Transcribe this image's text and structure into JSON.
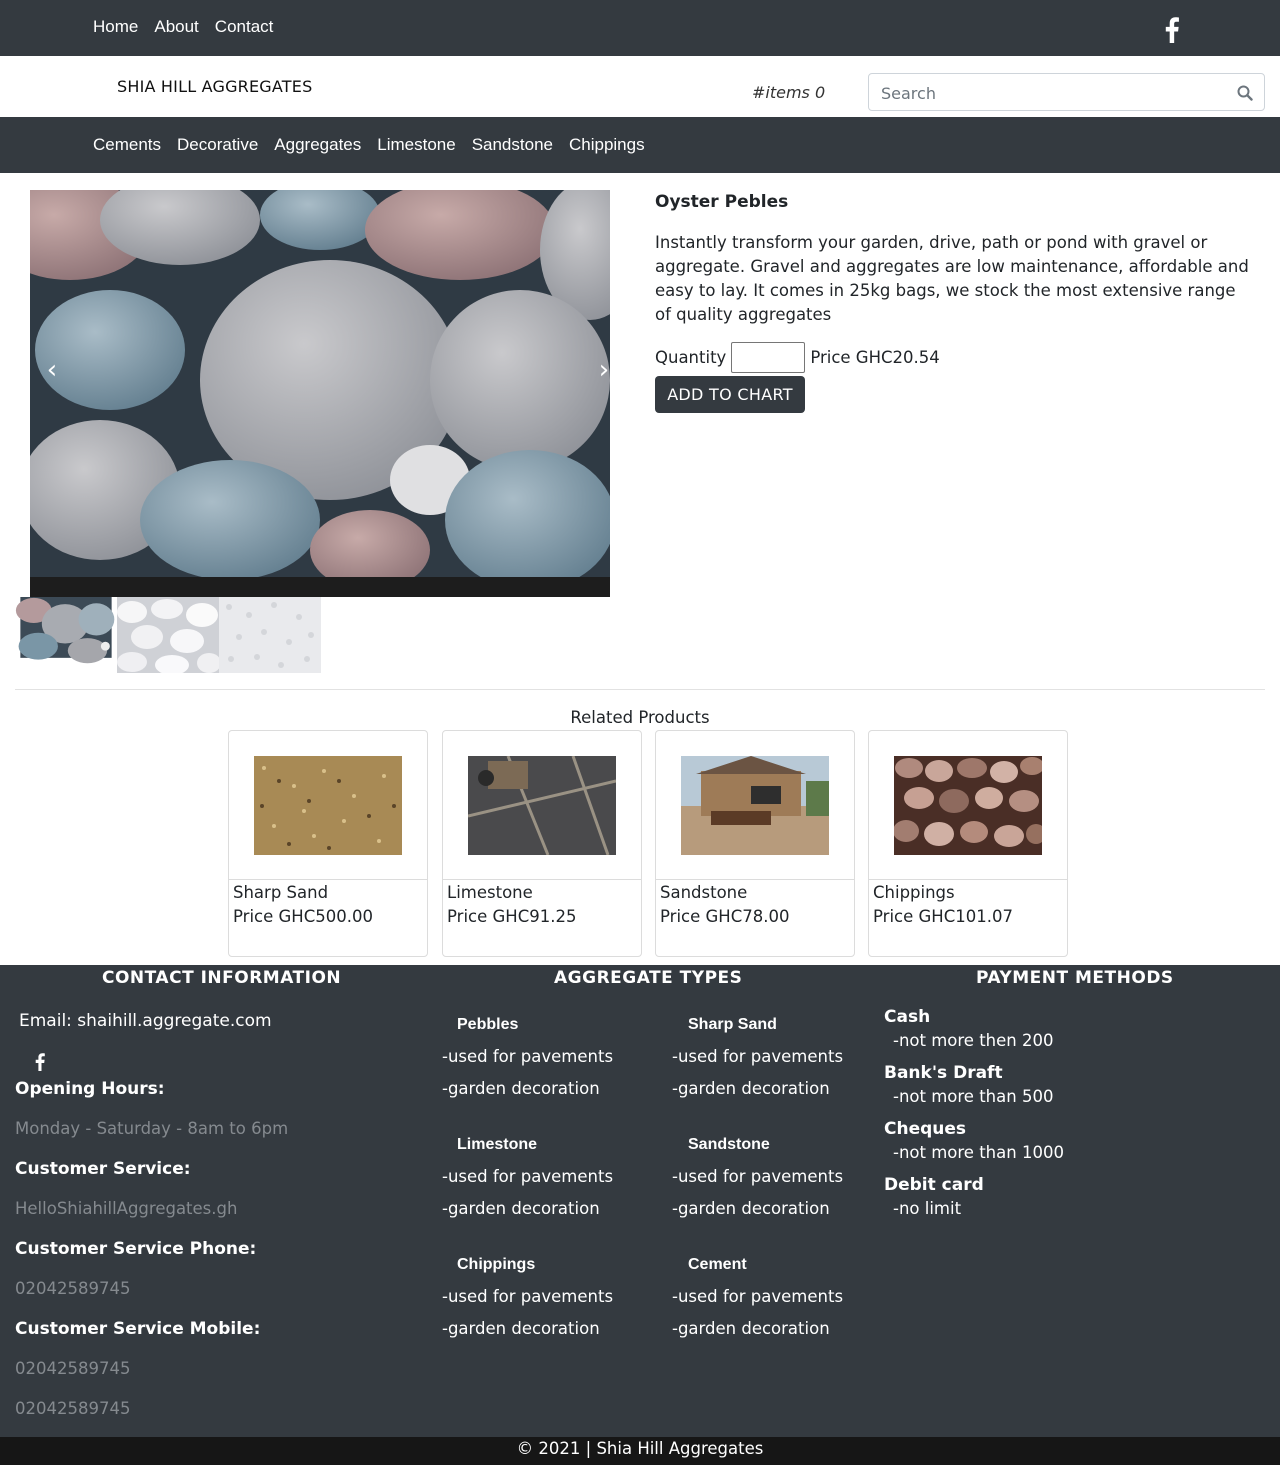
{
  "top_nav": {
    "links": [
      "Home",
      "About",
      "Contact"
    ],
    "social_icon": "facebook-icon"
  },
  "header": {
    "brand": "SHIA HILL AGGREGATES",
    "cart_count": "#items 0",
    "search_placeholder": "Search",
    "search_icon": "search-icon"
  },
  "categories": [
    "Cements",
    "Decorative",
    "Aggregates",
    "Limestone",
    "Sandstone",
    "Chippings"
  ],
  "product": {
    "title": "Oyster Pebles",
    "description": "Instantly transform your garden, drive, path or pond with gravel or aggregate. Gravel and aggregates are low maintenance, affordable and easy to lay. It comes in 25kg bags, we stock the most extensive range of quality aggregates",
    "quantity_label": "Quantity",
    "quantity_value": "",
    "price": "Price GHC20.54",
    "add_button": "ADD TO CHART",
    "carousel_prev": "‹",
    "carousel_next": "›"
  },
  "related": {
    "title": "Related Products",
    "items": [
      {
        "name": "Sharp Sand",
        "price": "Price GHC500.00"
      },
      {
        "name": "Limestone",
        "price": "Price GHC91.25"
      },
      {
        "name": "Sandstone",
        "price": "Price GHC78.00"
      },
      {
        "name": "Chippings",
        "price": "Price GHC101.07"
      }
    ]
  },
  "footer": {
    "contact": {
      "heading": "CONTACT INFORMATION",
      "email": "Email: shaihill.aggregate.com",
      "opening_label": "Opening Hours:",
      "opening_value": "Monday - Saturday - 8am to 6pm",
      "service_label": "Customer Service:",
      "service_value": "HelloShiahillAggregates.gh",
      "phone_label": "Customer Service Phone:",
      "phone_value": "02042589745",
      "mobile_label": "Customer Service Mobile:",
      "mobile_value_1": "02042589745",
      "mobile_value_2": "02042589745"
    },
    "aggregates": {
      "heading": "AGGREGATE TYPES",
      "types": [
        {
          "name": "Pebbles",
          "line1": "-used for pavements",
          "line2": "-garden decoration"
        },
        {
          "name": "Sharp Sand",
          "line1": "-used for pavements",
          "line2": "-garden decoration"
        },
        {
          "name": "Limestone",
          "line1": "-used for pavements",
          "line2": "-garden decoration"
        },
        {
          "name": "Sandstone",
          "line1": "-used for pavements",
          "line2": "-garden decoration"
        },
        {
          "name": "Chippings",
          "line1": "-used for pavements",
          "line2": "-garden decoration"
        },
        {
          "name": "Cement",
          "line1": "-used for pavements",
          "line2": "-garden decoration"
        }
      ]
    },
    "payment": {
      "heading": "PAYMENT METHODS",
      "methods": [
        {
          "name": "Cash",
          "limit": "-not more then 200"
        },
        {
          "name": "Bank's Draft",
          "limit": "-not more than 500"
        },
        {
          "name": "Cheques",
          "limit": "-not more than 1000"
        },
        {
          "name": "Debit card",
          "limit": "-no limit"
        }
      ]
    },
    "copyright": "© 2021 | Shia Hill Aggregates"
  },
  "colors": {
    "dark_bar": "#343a40",
    "copyright_bar": "#161616",
    "muted_text": "#858a8f"
  }
}
